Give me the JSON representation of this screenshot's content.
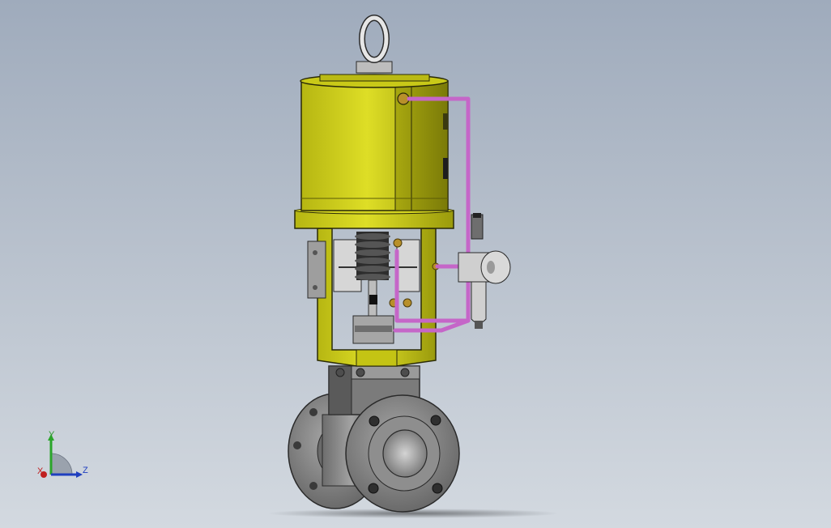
{
  "viewport": {
    "background_top": "#9fabbc",
    "background_bottom": "#d3d9e0"
  },
  "model": {
    "name": "pneumatic-control-valve",
    "colors": {
      "actuator": "#cccc16",
      "actuator_dark": "#8f8f0c",
      "valve_body": "#8a8a8a",
      "valve_body_dark": "#4a4a4a",
      "air_tubing": "#c566c8",
      "bracket": "#c8c8c8",
      "brass": "#b8902a"
    }
  },
  "triad": {
    "axis_y_label": "Y",
    "axis_z_label": "Z",
    "axis_x_label": "X",
    "colors": {
      "y": "#2aa52a",
      "z": "#1f3fbf",
      "x": "#c02020"
    }
  }
}
